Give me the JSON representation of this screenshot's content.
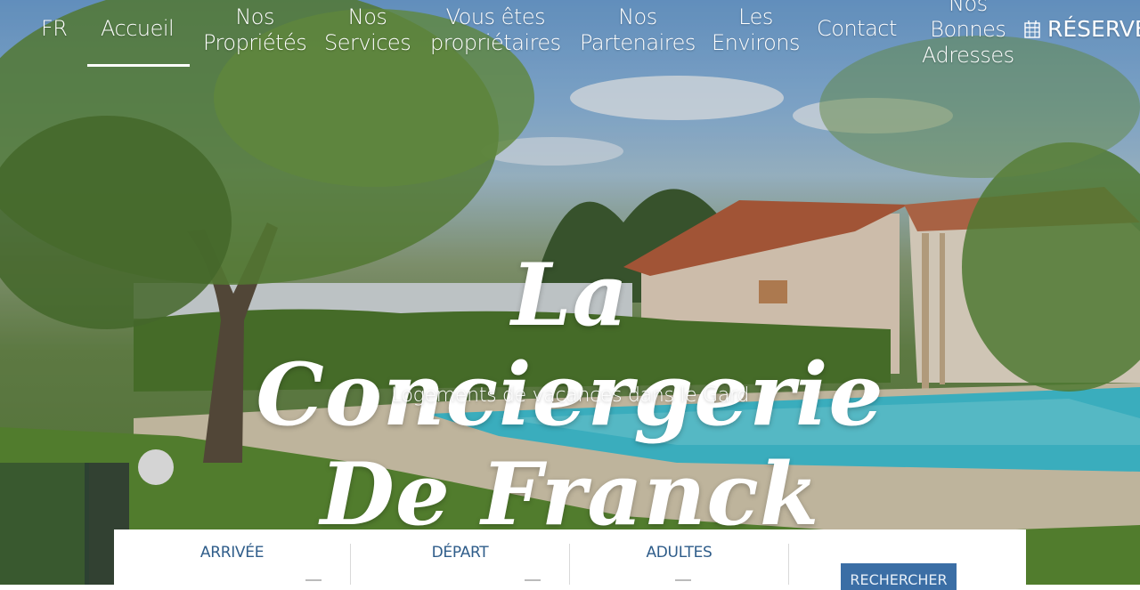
{
  "nav": {
    "language": "FR",
    "items": [
      {
        "line1": "Accueil",
        "line2": ""
      },
      {
        "line1": "Nos",
        "line2": "Propriétés"
      },
      {
        "line1": "Nos",
        "line2": "Services"
      },
      {
        "line1": "Vous êtes",
        "line2": "propriétaires"
      },
      {
        "line1": "Nos",
        "line2": "Partenaires"
      },
      {
        "line1": "Les",
        "line2": "Environs"
      },
      {
        "line1": "Contact",
        "line2": ""
      },
      {
        "line1": "Nos",
        "line2": "Bonnes",
        "line3": "Adresses"
      }
    ],
    "reserve": "RÉSERVER",
    "reserve_icon": "calendar-icon"
  },
  "hero": {
    "title": "La Conciergerie De Franck",
    "subtitle": "Logements de vacances dans le Gard"
  },
  "search": {
    "arrival_label": "ARRIVÉE",
    "departure_label": "DÉPART",
    "adults_label": "ADULTES",
    "button_label": "RECHERCHER"
  },
  "colors": {
    "accent": "#3b6ea5",
    "label": "#2f5d8a"
  }
}
